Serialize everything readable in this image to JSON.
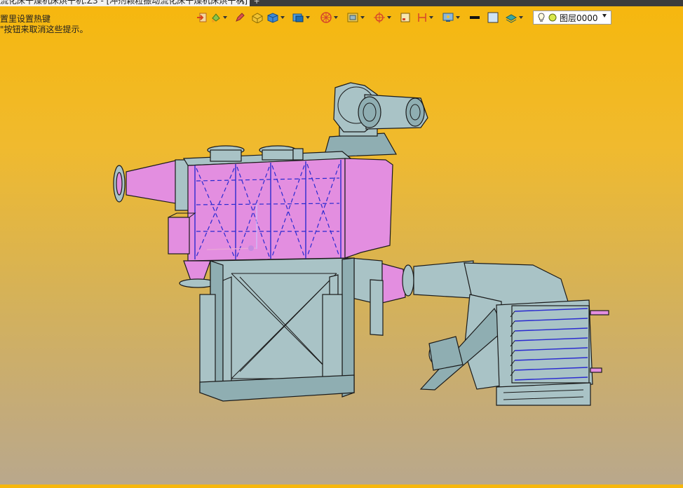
{
  "tab": {
    "title": "流化床干燥机床烘干机.Z3 - [冲剂颗粒振动流化床干燥机床烘干机]",
    "close_glyph": "✕",
    "new_tab_glyph": "+"
  },
  "hints": {
    "line1": "置里设置热键",
    "line2": "\"按钮来取消这些提示。"
  },
  "toolbar": {
    "icons": [
      "exit-icon",
      "paint-bucket-icon",
      "pen-icon",
      "box-icon",
      "cube-icon",
      "3d-shade-icon",
      "wheel-icon",
      "texture-icon",
      "target-icon",
      "rect-select-icon",
      "measure-icon",
      "display-icon",
      "line-color-icon",
      "fill-color-icon",
      "layers-icon"
    ]
  },
  "layer": {
    "name": "图层0000"
  },
  "colors": {
    "background_top": "#f6b70d",
    "background_bottom": "#b9a88c",
    "model_gray": "#a9c3c6",
    "model_pink": "#e38ee0",
    "edge_blue": "#2a2ad0"
  }
}
